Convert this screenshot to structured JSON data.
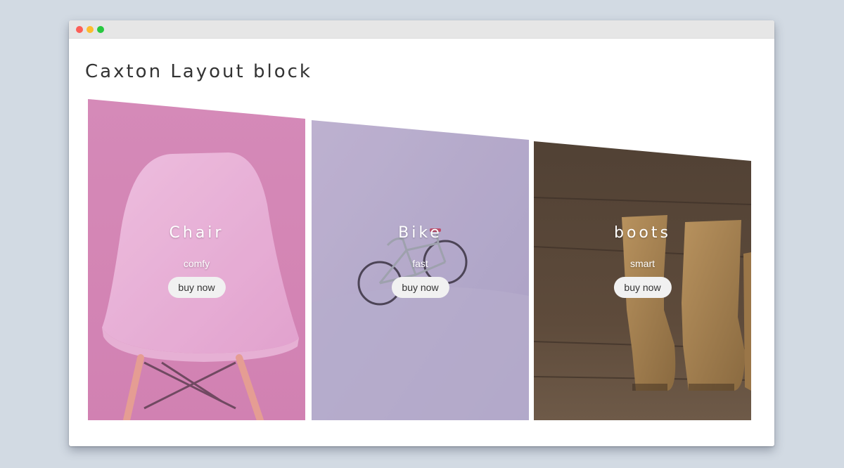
{
  "window": {
    "controls": [
      "close",
      "minimize",
      "maximize"
    ]
  },
  "page": {
    "title": "Caxton Layout block"
  },
  "cards": [
    {
      "title": "Chair",
      "subtitle": "comfy",
      "button": "buy now",
      "image": "pink-chair",
      "tint": "#d98fbf"
    },
    {
      "title": "Bike",
      "subtitle": "fast",
      "button": "buy now",
      "image": "bicycle-on-wall",
      "tint": "#b3a9c8"
    },
    {
      "title": "boots",
      "subtitle": "smart",
      "button": "buy now",
      "image": "leather-boots",
      "tint": "#5c4a3a"
    }
  ]
}
